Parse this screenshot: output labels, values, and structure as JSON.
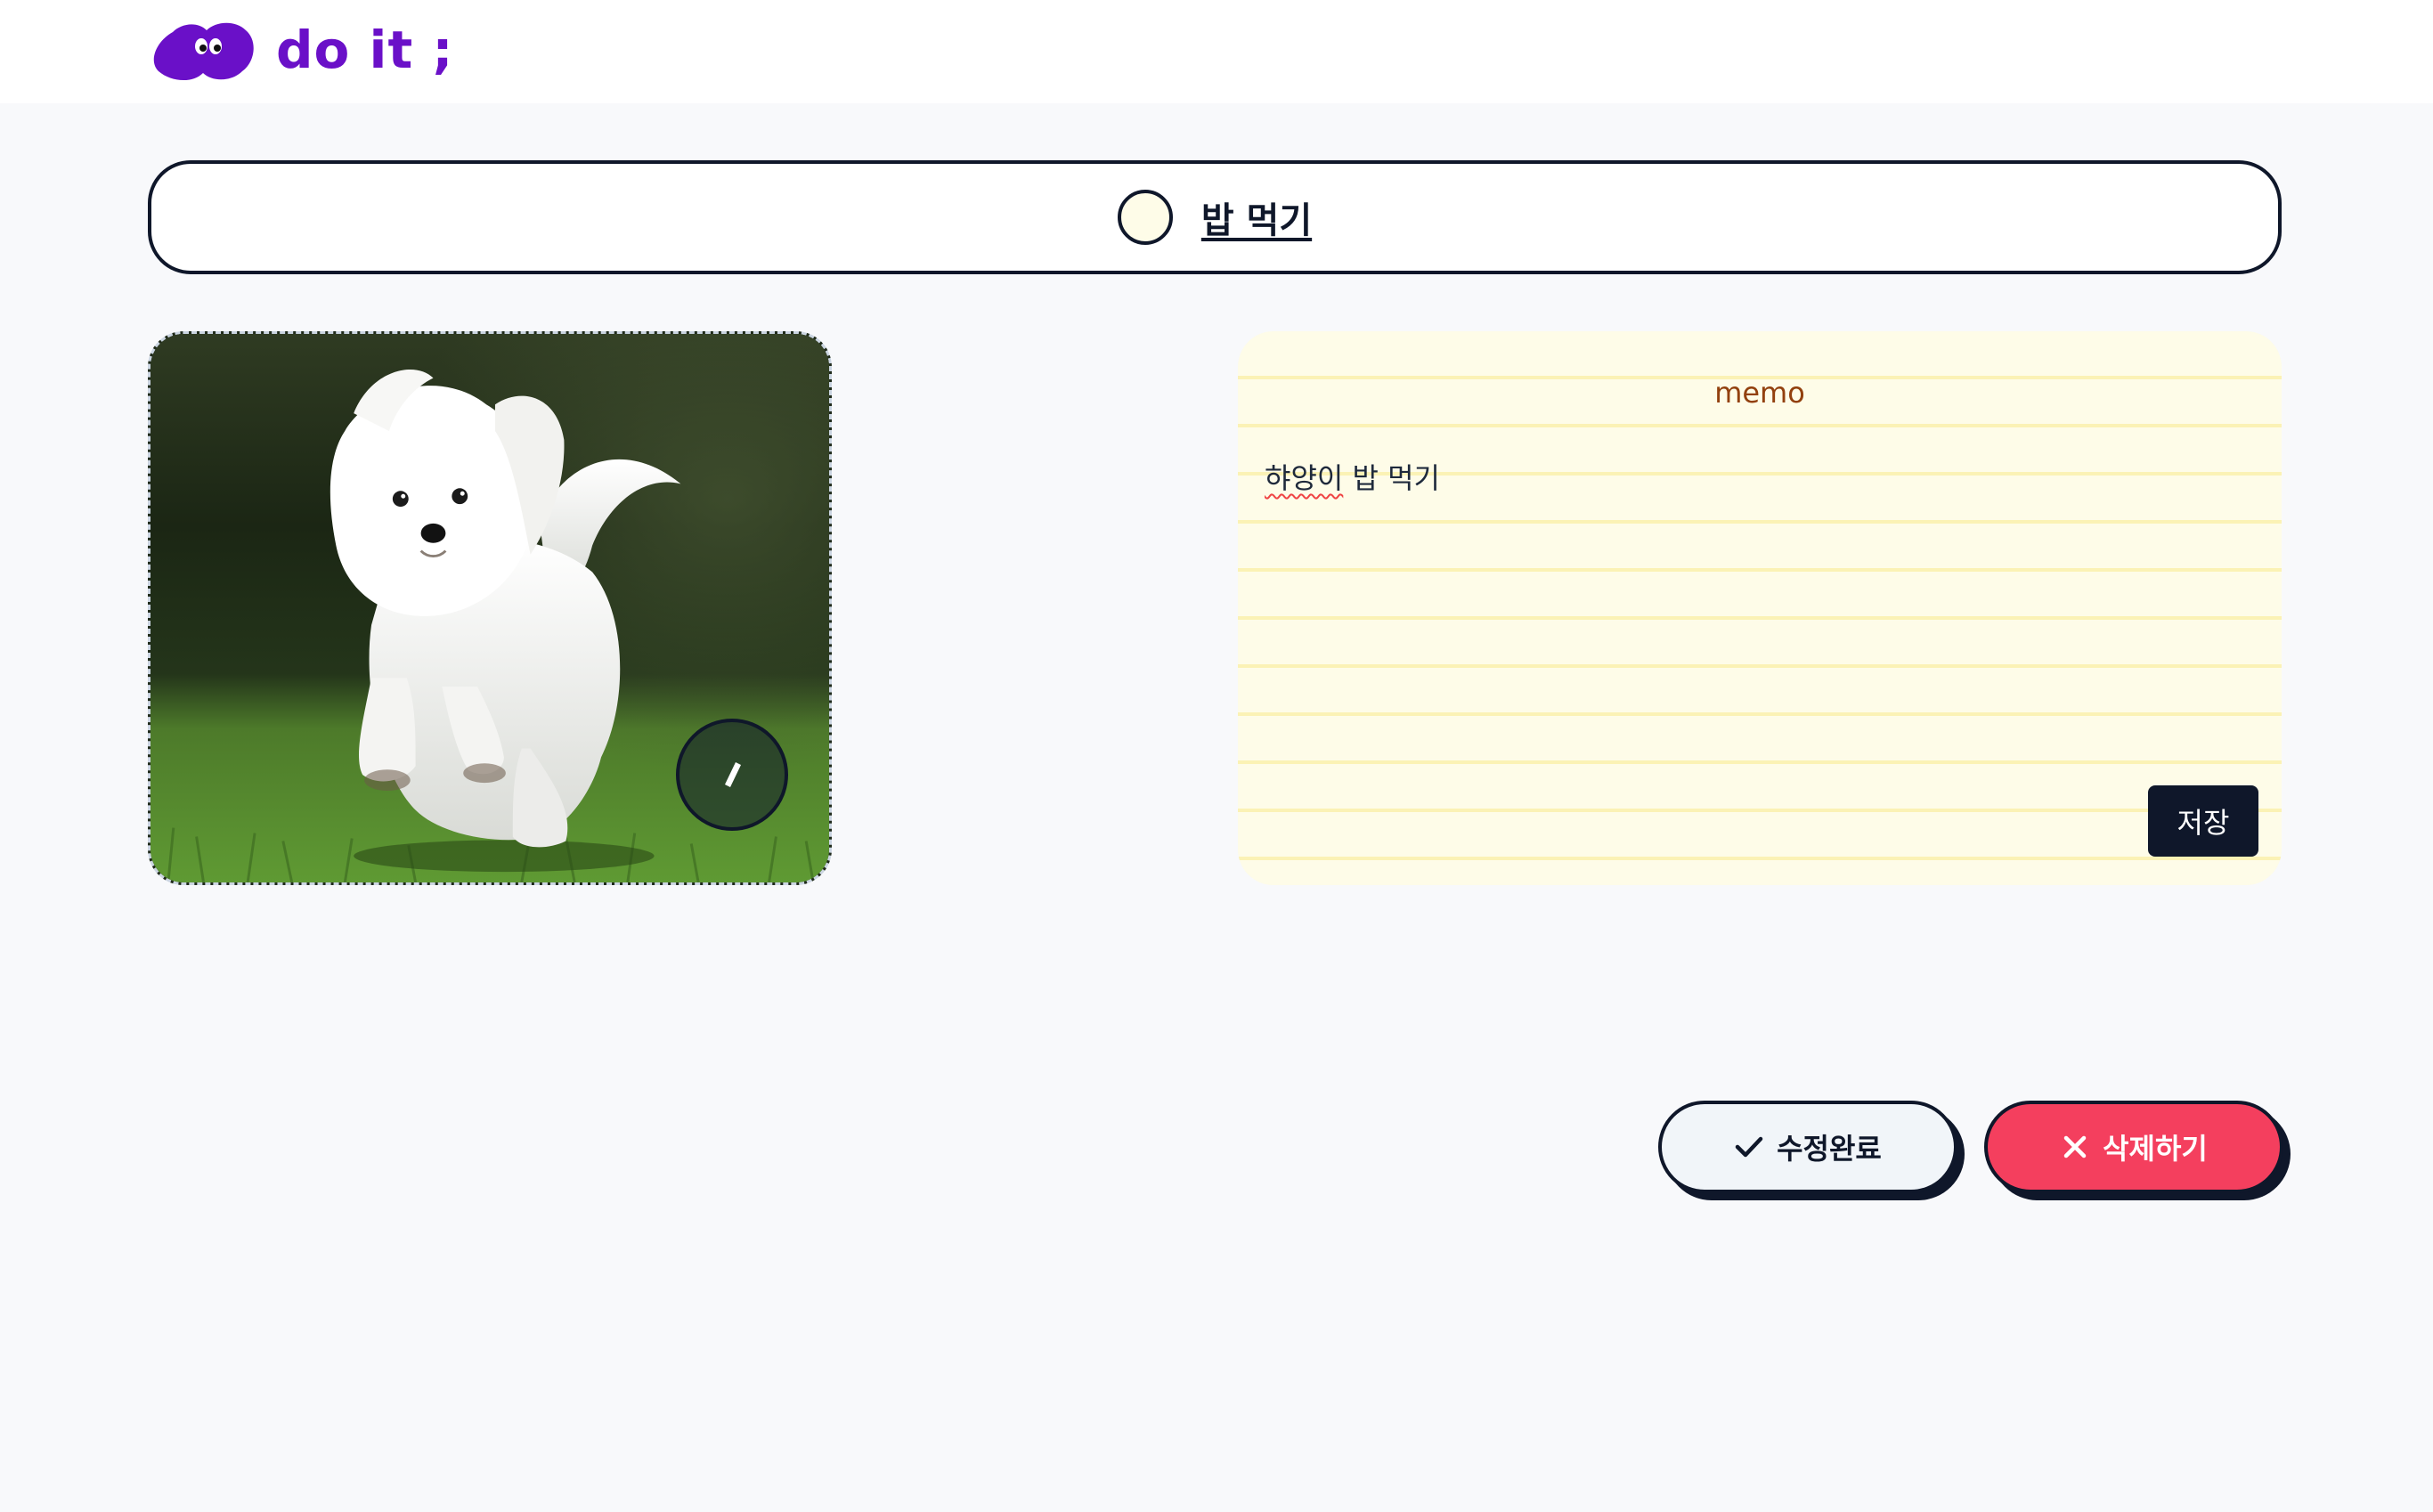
{
  "header": {
    "logo_text": "do it ;",
    "logo_icon": "cloud-eyes-logo"
  },
  "todo": {
    "name": "밥 먹기",
    "completed": false
  },
  "image": {
    "alt": "white fluffy dog running on grass",
    "edit_icon": "pencil-icon"
  },
  "memo": {
    "title": "memo",
    "content_spell": "햐양이",
    "content_rest": " 밥 먹기",
    "save_label": "저장"
  },
  "actions": {
    "edit_done_label": "수정완료",
    "edit_done_icon": "check-icon",
    "delete_label": "삭제하기",
    "delete_icon": "close-icon"
  },
  "colors": {
    "brand": "#6a10c8",
    "background": "#f8f9fb",
    "memo_background": "#fefce8",
    "memo_title": "#92400e",
    "delete": "#f43f5e",
    "dark": "#0f172a"
  }
}
